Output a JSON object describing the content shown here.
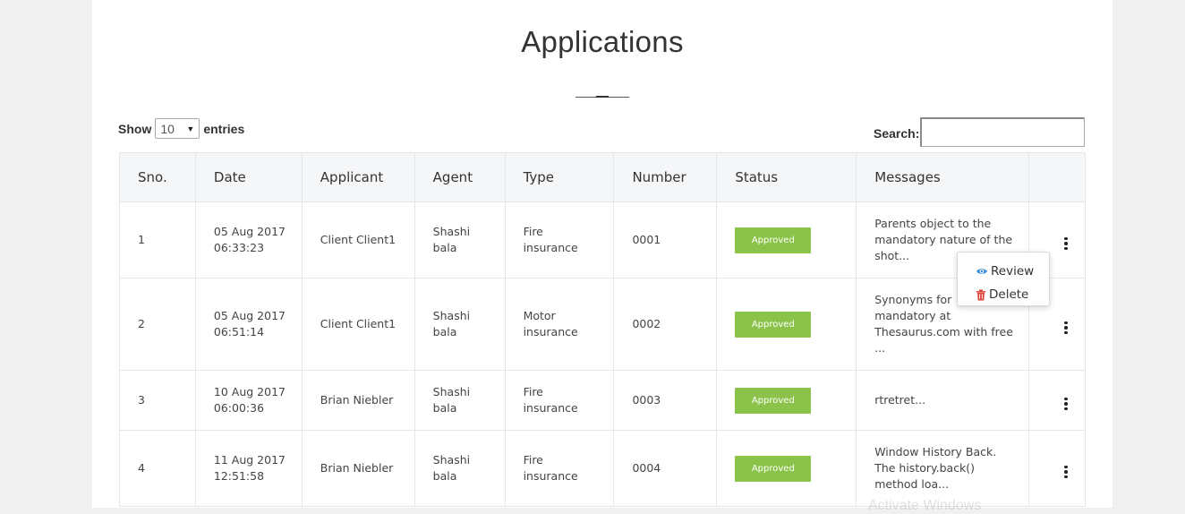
{
  "page": {
    "title": "Applications"
  },
  "controls": {
    "show_label": "Show",
    "entries_value": "10",
    "entries_label": "entries",
    "search_label": "Search:",
    "search_value": ""
  },
  "table": {
    "columns": [
      "Sno.",
      "Date",
      "Applicant",
      "Agent",
      "Type",
      "Number",
      "Status",
      "Messages",
      ""
    ],
    "rows": [
      {
        "sno": "1",
        "date_line1": "05 Aug 2017",
        "date_line2": "06:33:23",
        "applicant": "Client Client1",
        "agent_line1": "Shashi",
        "agent_line2": "bala",
        "type_line1": "Fire",
        "type_line2": "insurance",
        "number": "0001",
        "status": "Approved",
        "message": "Parents object to the mandatory nature of the shot..."
      },
      {
        "sno": "2",
        "date_line1": "05 Aug 2017",
        "date_line2": "06:51:14",
        "applicant": "Client Client1",
        "agent_line1": "Shashi",
        "agent_line2": "bala",
        "type_line1": "Motor",
        "type_line2": "insurance",
        "number": "0002",
        "status": "Approved",
        "message": "Synonyms for mandatory at Thesaurus.com with free ..."
      },
      {
        "sno": "3",
        "date_line1": "10 Aug 2017",
        "date_line2": "06:00:36",
        "applicant": "Brian Niebler",
        "agent_line1": "Shashi",
        "agent_line2": "bala",
        "type_line1": "Fire",
        "type_line2": "insurance",
        "number": "0003",
        "status": "Approved",
        "message": "rtretret..."
      },
      {
        "sno": "4",
        "date_line1": "11 Aug 2017",
        "date_line2": "12:51:58",
        "applicant": "Brian Niebler",
        "agent_line1": "Shashi",
        "agent_line2": "bala",
        "type_line1": "Fire",
        "type_line2": "insurance",
        "number": "0004",
        "status": "Approved",
        "message": "Window History Back. The history.back() method loa..."
      }
    ]
  },
  "dropdown": {
    "review_label": "Review",
    "delete_label": "Delete",
    "review_icon": "eye-icon",
    "delete_icon": "trash-icon"
  },
  "colors": {
    "status_approved": "#8bc34a",
    "review_icon": "#3a8fd8",
    "delete_icon": "#e0433c"
  },
  "watermark": "Activate Windows"
}
